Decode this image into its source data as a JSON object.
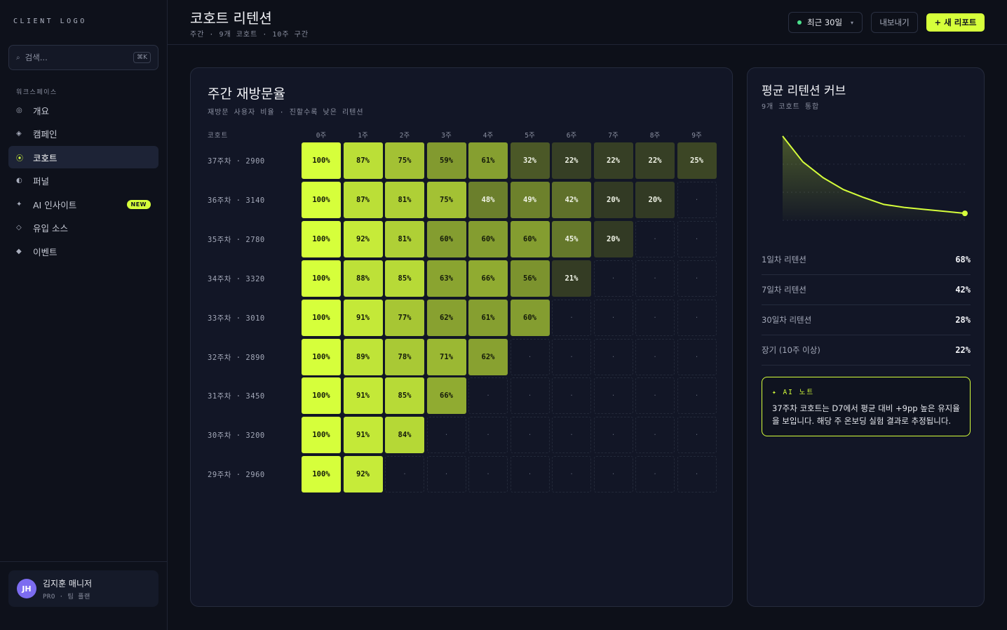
{
  "sidebar": {
    "logo": "CLIENT LOGO",
    "search_placeholder": "검색...",
    "search_shortcut": "⌘K",
    "section_label": "워크스페이스",
    "items": [
      {
        "label": "개요",
        "icon": "◎"
      },
      {
        "label": "캠페인",
        "icon": "◈"
      },
      {
        "label": "코호트",
        "icon": "⦿"
      },
      {
        "label": "퍼널",
        "icon": "◐"
      },
      {
        "label": "AI 인사이트",
        "icon": "✦",
        "badge": "NEW"
      },
      {
        "label": "유입 소스",
        "icon": "◇"
      },
      {
        "label": "이벤트",
        "icon": "◆"
      }
    ],
    "user": {
      "initials": "JH",
      "name": "김지훈 매니저",
      "plan": "PRO · 팀 플랜"
    }
  },
  "header": {
    "title": "코호트 리텐션",
    "subtitle": "주간 · 9개 코호트 · 10주 구간",
    "range_label": "최근 30일",
    "export_label": "내보내기",
    "new_report_label": "+ 새 리포트"
  },
  "retention": {
    "title": "주간 재방문율",
    "subtitle": "재방문 사용자 비율 · 진할수록 낮은 리텐션",
    "cohort_header": "코호트",
    "weeks": [
      "0주",
      "1주",
      "2주",
      "3주",
      "4주",
      "5주",
      "6주",
      "7주",
      "8주",
      "9주"
    ],
    "empty_mark": "·",
    "rows": [
      {
        "label": "37주차 · 2900",
        "values": [
          "100%",
          "87%",
          "75%",
          "59%",
          "61%",
          "32%",
          "22%",
          "22%",
          "22%",
          "25%"
        ]
      },
      {
        "label": "36주차 · 3140",
        "values": [
          "100%",
          "87%",
          "81%",
          "75%",
          "48%",
          "49%",
          "42%",
          "20%",
          "20%"
        ]
      },
      {
        "label": "35주차 · 2780",
        "values": [
          "100%",
          "92%",
          "81%",
          "60%",
          "60%",
          "60%",
          "45%",
          "20%"
        ]
      },
      {
        "label": "34주차 · 3320",
        "values": [
          "100%",
          "88%",
          "85%",
          "63%",
          "66%",
          "56%",
          "21%"
        ]
      },
      {
        "label": "33주차 · 3010",
        "values": [
          "100%",
          "91%",
          "77%",
          "62%",
          "61%",
          "60%"
        ]
      },
      {
        "label": "32주차 · 2890",
        "values": [
          "100%",
          "89%",
          "78%",
          "71%",
          "62%"
        ]
      },
      {
        "label": "31주차 · 3450",
        "values": [
          "100%",
          "91%",
          "85%",
          "66%"
        ]
      },
      {
        "label": "30주차 · 3200",
        "values": [
          "100%",
          "91%",
          "84%"
        ]
      },
      {
        "label": "29주차 · 2960",
        "values": [
          "100%",
          "92%"
        ]
      }
    ]
  },
  "curve": {
    "title": "평균 리텐션 커브",
    "subtitle": "9개 코호트 통합",
    "values": [
      100,
      74,
      58,
      46,
      38,
      31,
      28,
      26,
      24,
      22
    ],
    "color": "#d6ff3b"
  },
  "metrics": [
    {
      "label": "1일차 리텐션",
      "value": "68%"
    },
    {
      "label": "7일차 리텐션",
      "value": "42%"
    },
    {
      "label": "30일차 리텐션",
      "value": "28%"
    },
    {
      "label": "장기 (10주 이상)",
      "value": "22%"
    }
  ],
  "ai_note": {
    "label": "✦ AI 노트",
    "text": "37주차 코호트는 D7에서 평균 대비 +9pp 높은 유지율을 보입니다. 해당 주 온보딩 실험 결과로 추정됩니다."
  },
  "colors": {
    "accent": "#d6ff3b",
    "status_dot": "#4be08c",
    "avatar": "#7c6cf0"
  }
}
